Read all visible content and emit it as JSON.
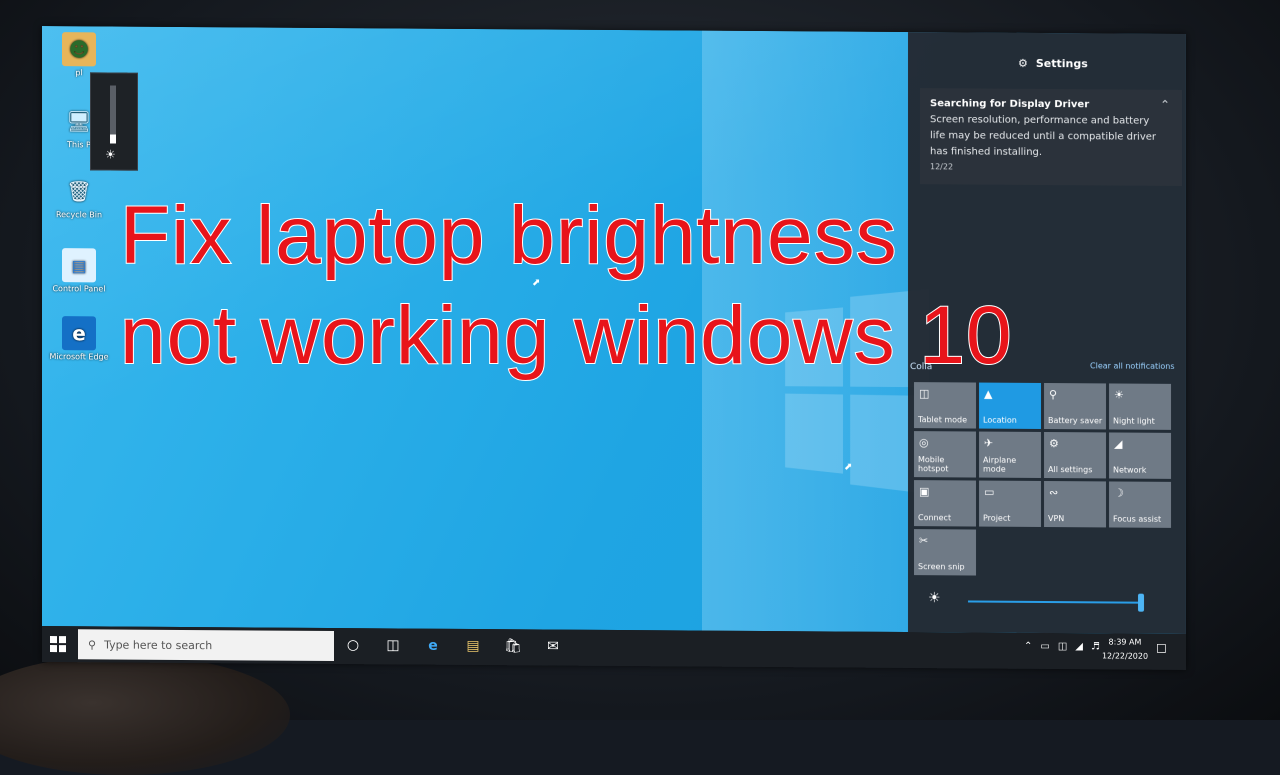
{
  "overlay": {
    "line1": "Fix laptop brightness",
    "line2": "not working windows 10"
  },
  "desktop_icons": [
    {
      "label": "pl",
      "icon": "user-folder-icon"
    },
    {
      "label": "This P",
      "icon": "computer-icon"
    },
    {
      "label": "Recycle Bin",
      "icon": "recycle-bin-icon"
    },
    {
      "label": "Control Panel",
      "icon": "control-panel-icon"
    },
    {
      "label": "Microsoft Edge",
      "icon": "edge-icon"
    }
  ],
  "brightness_flyout": {
    "level": 0.15,
    "icon": "sun-icon"
  },
  "action_center": {
    "header": "Settings",
    "notification": {
      "title": "Searching for Display Driver",
      "body": "Screen resolution, performance and battery life may be reduced until a compatible driver has finished installing.",
      "date": "12/22"
    },
    "collapse_label": "Colla",
    "clear_label": "Clear all notifications",
    "tiles": [
      {
        "label": "Tablet mode",
        "icon": "tablet-mode-icon",
        "active": false
      },
      {
        "label": "Location",
        "icon": "location-icon",
        "active": true
      },
      {
        "label": "Battery saver",
        "icon": "battery-saver-icon",
        "active": false
      },
      {
        "label": "Night light",
        "icon": "night-light-icon",
        "active": false
      },
      {
        "label": "Mobile hotspot",
        "icon": "mobile-hotspot-icon",
        "active": false
      },
      {
        "label": "Airplane mode",
        "icon": "airplane-icon",
        "active": false
      },
      {
        "label": "All settings",
        "icon": "settings-icon",
        "active": false
      },
      {
        "label": "Network",
        "icon": "network-icon",
        "active": false
      },
      {
        "label": "Connect",
        "icon": "connect-icon",
        "active": false
      },
      {
        "label": "Project",
        "icon": "project-icon",
        "active": false
      },
      {
        "label": "VPN",
        "icon": "vpn-icon",
        "active": false
      },
      {
        "label": "Focus assist",
        "icon": "focus-assist-icon",
        "active": false
      },
      {
        "label": "Screen snip",
        "icon": "screen-snip-icon",
        "active": false
      }
    ],
    "brightness_level": 1.0
  },
  "taskbar": {
    "search_placeholder": "Type here to search",
    "time": "8:39 AM",
    "date": "12/22/2020"
  },
  "colors": {
    "accent": "#1f9ae3",
    "overlay_text": "#e8141a",
    "taskbar": "#1b1f24"
  }
}
